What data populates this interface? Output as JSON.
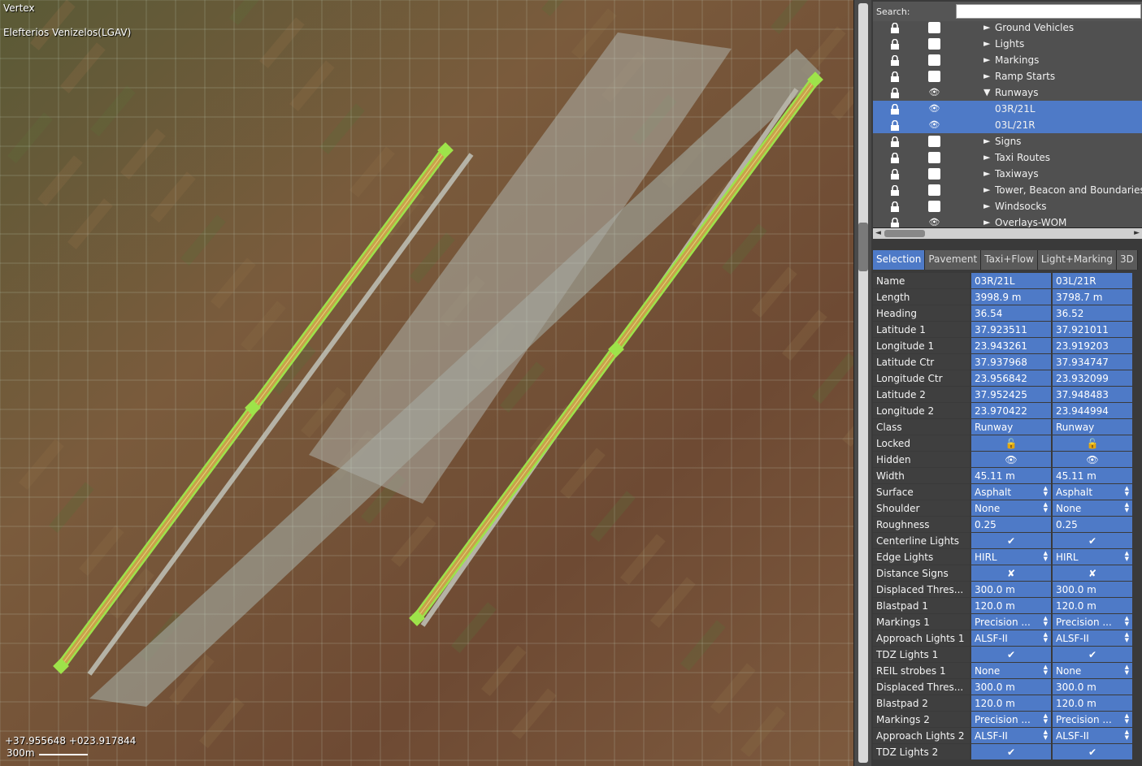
{
  "map": {
    "title": "Vertex",
    "airport": "Elefterios Venizelos(LGAV)",
    "coords": "+37.955648 +023.917844",
    "scale": "300m"
  },
  "search": {
    "label": "Search:",
    "value": ""
  },
  "tree": {
    "items": [
      {
        "label": "Ground Vehicles",
        "arrow": "►",
        "visible": false,
        "selected": false
      },
      {
        "label": "Lights",
        "arrow": "►",
        "visible": false,
        "selected": false
      },
      {
        "label": "Markings",
        "arrow": "►",
        "visible": false,
        "selected": false
      },
      {
        "label": "Ramp Starts",
        "arrow": "►",
        "visible": false,
        "selected": false
      },
      {
        "label": "Runways",
        "arrow": "▼",
        "visible": true,
        "selected": false
      },
      {
        "label": "03R/21L",
        "arrow": "",
        "visible": true,
        "selected": true
      },
      {
        "label": "03L/21R",
        "arrow": "",
        "visible": true,
        "selected": true
      },
      {
        "label": "Signs",
        "arrow": "►",
        "visible": false,
        "selected": false
      },
      {
        "label": "Taxi Routes",
        "arrow": "►",
        "visible": false,
        "selected": false
      },
      {
        "label": "Taxiways",
        "arrow": "►",
        "visible": false,
        "selected": false
      },
      {
        "label": "Tower, Beacon and Boundaries",
        "arrow": "►",
        "visible": false,
        "selected": false
      },
      {
        "label": "Windsocks",
        "arrow": "►",
        "visible": false,
        "selected": false
      },
      {
        "label": "Overlays-WOM",
        "arrow": "►",
        "visible": true,
        "selected": false
      }
    ]
  },
  "tabs": [
    "Selection",
    "Pavement",
    "Taxi+Flow",
    "Light+Marking",
    "3D"
  ],
  "props": [
    {
      "name": "Name",
      "v1": "03R/21L",
      "v2": "03L/21R"
    },
    {
      "name": "Length",
      "v1": "3998.9 m",
      "v2": "3798.7 m"
    },
    {
      "name": "Heading",
      "v1": "36.54",
      "v2": "36.52"
    },
    {
      "name": "Latitude 1",
      "v1": " 37.923511",
      "v2": " 37.921011"
    },
    {
      "name": "Longitude 1",
      "v1": " 23.943261",
      "v2": " 23.919203"
    },
    {
      "name": "Latitude Ctr",
      "v1": " 37.937968",
      "v2": " 37.934747"
    },
    {
      "name": "Longitude Ctr",
      "v1": " 23.956842",
      "v2": " 23.932099"
    },
    {
      "name": "Latitude 2",
      "v1": " 37.952425",
      "v2": " 37.948483"
    },
    {
      "name": "Longitude 2",
      "v1": " 23.970422",
      "v2": " 23.944994"
    },
    {
      "name": "Class",
      "v1": "Runway",
      "v2": "Runway"
    },
    {
      "name": "Locked",
      "v1": "🔓",
      "v2": "🔓",
      "center": true
    },
    {
      "name": "Hidden",
      "v1": "👁",
      "v2": "👁",
      "center": true
    },
    {
      "name": "Width",
      "v1": " 45.11 m",
      "v2": " 45.11 m"
    },
    {
      "name": "Surface",
      "v1": "Asphalt",
      "v2": "Asphalt",
      "spin": true
    },
    {
      "name": "Shoulder",
      "v1": "None",
      "v2": "None",
      "spin": true
    },
    {
      "name": "Roughness",
      "v1": "0.25",
      "v2": "0.25"
    },
    {
      "name": "Centerline Lights",
      "v1": "✔",
      "v2": "✔",
      "center": true
    },
    {
      "name": "Edge Lights",
      "v1": "HIRL",
      "v2": "HIRL",
      "spin": true
    },
    {
      "name": "Distance Signs",
      "v1": "✘",
      "v2": "✘",
      "center": true
    },
    {
      "name": "Displaced Thres...",
      "v1": " 300.0 m",
      "v2": " 300.0 m"
    },
    {
      "name": "Blastpad 1",
      "v1": " 120.0 m",
      "v2": " 120.0 m"
    },
    {
      "name": "Markings 1",
      "v1": "Precision ...",
      "v2": "Precision ...",
      "spin": true
    },
    {
      "name": "Approach Lights 1",
      "v1": "ALSF-II",
      "v2": "ALSF-II",
      "spin": true
    },
    {
      "name": "TDZ Lights 1",
      "v1": "✔",
      "v2": "✔",
      "center": true
    },
    {
      "name": "REIL strobes 1",
      "v1": "None",
      "v2": "None",
      "spin": true
    },
    {
      "name": "Displaced Thres...",
      "v1": " 300.0 m",
      "v2": " 300.0 m"
    },
    {
      "name": "Blastpad 2",
      "v1": " 120.0 m",
      "v2": " 120.0 m"
    },
    {
      "name": "Markings 2",
      "v1": "Precision ...",
      "v2": "Precision ...",
      "spin": true
    },
    {
      "name": "Approach Lights 2",
      "v1": "ALSF-II",
      "v2": "ALSF-II",
      "spin": true
    },
    {
      "name": "TDZ Lights 2",
      "v1": "✔",
      "v2": "✔",
      "center": true
    }
  ],
  "colors": {
    "selection": "#4e7ac7",
    "runway_highlight": "#9ee34a",
    "runway_fill": "#c8a24a"
  }
}
